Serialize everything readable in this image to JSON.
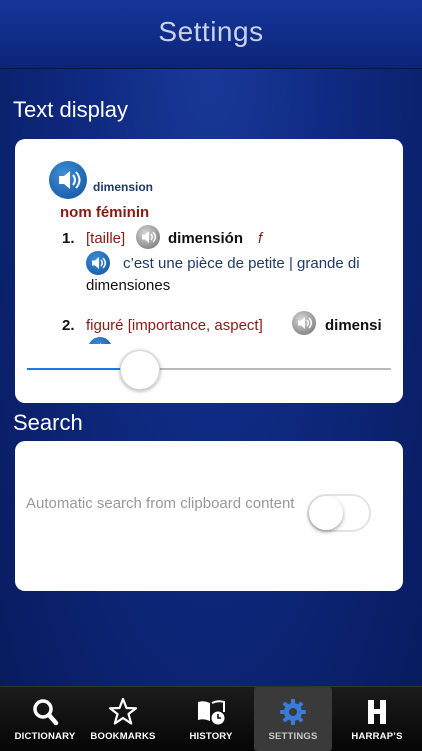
{
  "header": {
    "title": "Settings"
  },
  "text_display": {
    "section_title": "Text display",
    "preview": {
      "headword": "dimension",
      "part_of_speech": "nom féminin",
      "sense1_number": "1.",
      "sense1_label": "[taille]",
      "sense1_translation": "dimensión",
      "sense1_gender": "f",
      "example_source": "c’est une pièce de petite | grande di",
      "example_target": "dimensiones",
      "sense2_number": "2.",
      "sense2_label": "figuré [importance, aspect]",
      "sense2_translation": "dimensi"
    },
    "font_size_slider": {
      "value": 0.3
    }
  },
  "search": {
    "section_title": "Search",
    "auto_search_label": "Automatic search from clipboard content",
    "auto_search_enabled": false
  },
  "tabbar": {
    "tabs": [
      {
        "label": "DICTIONARY",
        "icon": "search-icon"
      },
      {
        "label": "BOOKMARKS",
        "icon": "star-icon"
      },
      {
        "label": "HISTORY",
        "icon": "book-clock-icon"
      },
      {
        "label": "SETTINGS",
        "icon": "gear-icon"
      },
      {
        "label": "HARRAP’S",
        "icon": "harraps-logo-icon"
      }
    ],
    "active": "SETTINGS"
  },
  "colors": {
    "accent_blue": "#1e7be0",
    "entry_red": "#8b1a14",
    "entry_blue": "#1d3a6b"
  }
}
